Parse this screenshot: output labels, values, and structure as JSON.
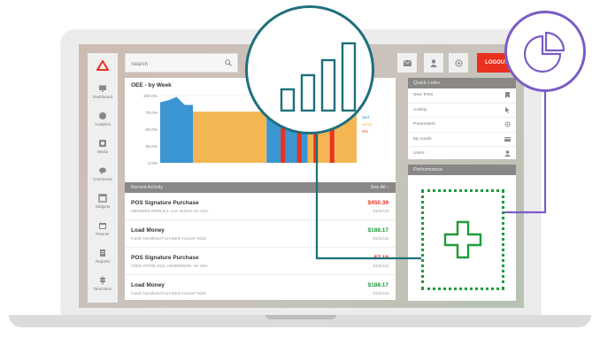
{
  "colors": {
    "accent_red": "#e8321f",
    "chart_blue": "#2f8fd0",
    "chart_orange": "#f2b24a",
    "chart_red": "#e8321f",
    "panel_gray": "#8a8886",
    "teal": "#1f6f7c",
    "purple": "#7a5cc6",
    "green": "#1f9b3a"
  },
  "sidebar": {
    "items": [
      {
        "label": "Dashboard",
        "icon": "monitor-icon"
      },
      {
        "label": "Analytics",
        "icon": "globe-icon"
      },
      {
        "label": "Media",
        "icon": "media-icon"
      },
      {
        "label": "Comments",
        "icon": "comments-icon"
      },
      {
        "label": "Widgets",
        "icon": "window-icon"
      },
      {
        "label": "Planner",
        "icon": "calendar-icon"
      },
      {
        "label": "Reports",
        "icon": "document-icon"
      },
      {
        "label": "Directions",
        "icon": "signpost-icon"
      }
    ]
  },
  "topbar": {
    "search_placeholder": "Search",
    "logout_label": "LOGOUT"
  },
  "chart": {
    "title": "OEE - by Week"
  },
  "chart_data": {
    "type": "area",
    "title": "OEE - by Week",
    "ylim": [
      0,
      100
    ],
    "yticks": [
      "100.0%",
      "75.0%",
      "50.0%",
      "25.0%",
      "0.0%"
    ],
    "legend_partial": [
      "and",
      "ound",
      "0%"
    ],
    "series": [
      {
        "name": "",
        "color": "#2f8fd0",
        "x": [
          0,
          1,
          2,
          3,
          4
        ],
        "values": [
          90,
          93,
          98,
          86,
          86
        ]
      },
      {
        "name": "",
        "color": "#f2b24a",
        "x": [
          4,
          5,
          6,
          7,
          8,
          9,
          10,
          11,
          12,
          13
        ],
        "values": [
          76,
          76,
          76,
          76,
          76,
          76,
          76,
          76,
          76,
          76
        ]
      },
      {
        "name": "",
        "color": "#2f8fd0",
        "x": [
          13,
          14,
          15,
          16,
          17,
          18
        ],
        "values": [
          86,
          86,
          86,
          86,
          86,
          86
        ]
      },
      {
        "name": "",
        "color": "#f2b24a",
        "x": [
          18,
          19,
          20,
          21,
          22,
          23,
          24
        ],
        "values": [
          76,
          76,
          76,
          76,
          76,
          76,
          76
        ]
      }
    ],
    "highlight_bars": [
      15,
      17,
      19,
      21
    ]
  },
  "activity": {
    "header": "Recent Activity",
    "view_all": "See All",
    "rows": [
      {
        "title": "POS Signature Purchase",
        "sub": "SMOKERS WORLD II, LAS VEGAS, NV USA",
        "amount": "$450.39",
        "date": "01/01/13",
        "color": "#e8321f"
      },
      {
        "title": "Load Money",
        "sub": "Funds Transfered From Bank Account *5015",
        "amount": "$188.17",
        "date": "01/01/13",
        "color": "#1f9b3a"
      },
      {
        "title": "POS Signature Purchase",
        "sub": "VONS STORE 2011, HENDERSON, NV USA",
        "amount": "$7.19",
        "date": "01/01/13",
        "color": "#e8321f"
      },
      {
        "title": "Load Money",
        "sub": "Funds Transfered From Bank Account *5015",
        "amount": "$188.17",
        "date": "01/01/13",
        "color": "#1f9b3a"
      }
    ]
  },
  "quick_links": {
    "header": "Quick Links",
    "items": [
      {
        "label": "New Tests",
        "icon": "bookmark-icon"
      },
      {
        "label": "Activity",
        "icon": "cursor-icon"
      },
      {
        "label": "Parameters",
        "icon": "gear-icon"
      },
      {
        "label": "My Cards",
        "icon": "card-icon"
      },
      {
        "label": "Users",
        "icon": "user-icon"
      }
    ]
  },
  "performance": {
    "header": "Performance"
  }
}
